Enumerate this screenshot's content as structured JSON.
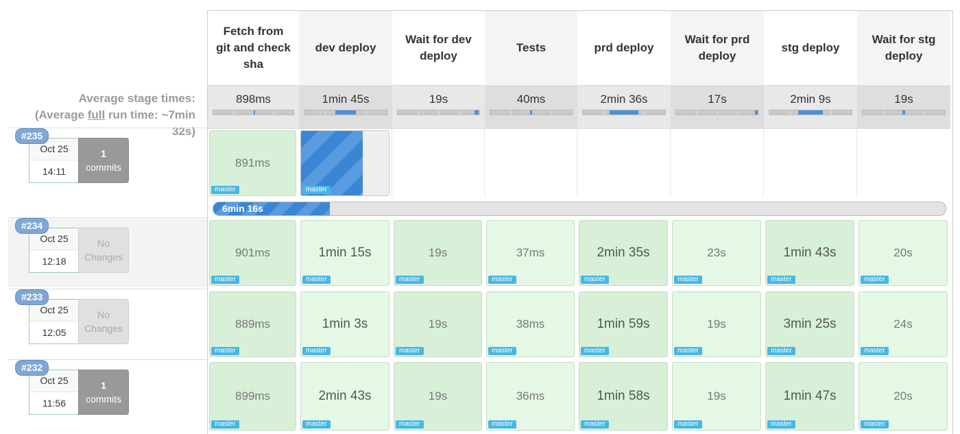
{
  "average": {
    "line1": "Average stage times:",
    "line2_pre": "(Average ",
    "line2_u": "full",
    "line2_post": " run time: ~7min",
    "line3": "32s)"
  },
  "stages": [
    {
      "name": "Fetch from git and check sha",
      "avg": "898ms",
      "fill": 0.0
    },
    {
      "name": "dev deploy",
      "avg": "1min 45s",
      "fill": 0.25
    },
    {
      "name": "Wait for dev deploy",
      "avg": "19s",
      "fill": 0.05
    },
    {
      "name": "Tests",
      "avg": "40ms",
      "fill": 0.02
    },
    {
      "name": "prd deploy",
      "avg": "2min 36s",
      "fill": 0.35
    },
    {
      "name": "Wait for prd deploy",
      "avg": "17s",
      "fill": 0.03
    },
    {
      "name": "stg deploy",
      "avg": "2min 9s",
      "fill": 0.3
    },
    {
      "name": "Wait for stg deploy",
      "avg": "19s",
      "fill": 0.03
    }
  ],
  "branch_tag": "master",
  "running_progress": "6min 16s",
  "builds": [
    {
      "id": "#235",
      "date": "Oct 25",
      "time": "14:11",
      "changes_n": "1",
      "changes_t": "commits",
      "has_changes": true,
      "cells": [
        "891ms",
        "",
        "",
        "",
        "",
        "",
        "",
        ""
      ]
    },
    {
      "id": "#234",
      "date": "Oct 25",
      "time": "12:18",
      "changes_n": "No",
      "changes_t": "Changes",
      "has_changes": false,
      "cells": [
        "901ms",
        "1min 15s",
        "19s",
        "37ms",
        "2min 35s",
        "23s",
        "1min 43s",
        "20s"
      ]
    },
    {
      "id": "#233",
      "date": "Oct 25",
      "time": "12:05",
      "changes_n": "No",
      "changes_t": "Changes",
      "has_changes": false,
      "cells": [
        "889ms",
        "1min 3s",
        "19s",
        "38ms",
        "1min 59s",
        "19s",
        "3min 25s",
        "24s"
      ]
    },
    {
      "id": "#232",
      "date": "Oct 25",
      "time": "11:56",
      "changes_n": "1",
      "changes_t": "commits",
      "has_changes": true,
      "cells": [
        "899ms",
        "2min 43s",
        "19s",
        "36ms",
        "1min 58s",
        "19s",
        "1min 47s",
        "20s"
      ]
    }
  ]
}
